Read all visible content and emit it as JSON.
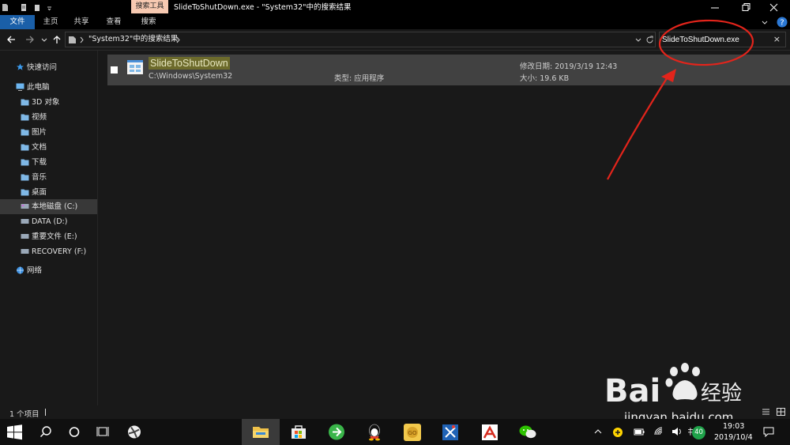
{
  "window": {
    "title": "SlideToShutDown.exe - \"System32\"中的搜索结果",
    "context_tab": "搜索工具"
  },
  "ribbon": {
    "tabs": [
      {
        "label": "文件"
      },
      {
        "label": "主页"
      },
      {
        "label": "共享"
      },
      {
        "label": "查看"
      },
      {
        "label": "搜索"
      }
    ]
  },
  "address": {
    "breadcrumb": "\"System32\"中的搜索结果"
  },
  "search": {
    "value": "SlideToShutDown.exe",
    "clear_icon": "×"
  },
  "sidebar": {
    "items": [
      {
        "label": "快速访问",
        "icon": "star-icon"
      },
      {
        "label": "此电脑",
        "icon": "pc-icon"
      },
      {
        "label": "3D 对象",
        "icon": "folder-icon"
      },
      {
        "label": "视频",
        "icon": "folder-icon"
      },
      {
        "label": "图片",
        "icon": "folder-icon"
      },
      {
        "label": "文档",
        "icon": "folder-icon"
      },
      {
        "label": "下载",
        "icon": "folder-icon"
      },
      {
        "label": "音乐",
        "icon": "folder-icon"
      },
      {
        "label": "桌面",
        "icon": "folder-icon"
      },
      {
        "label": "本地磁盘 (C:)",
        "icon": "drive-icon",
        "selected": true
      },
      {
        "label": "DATA (D:)",
        "icon": "drive-icon"
      },
      {
        "label": "重要文件 (E:)",
        "icon": "drive-icon"
      },
      {
        "label": "RECOVERY (F:)",
        "icon": "drive-icon"
      },
      {
        "label": "网络",
        "icon": "network-icon"
      }
    ]
  },
  "results": [
    {
      "name": "SlideToShutDown",
      "path": "C:\\Windows\\System32",
      "type": "类型: 应用程序",
      "modified": "修改日期: 2019/3/19 12:43",
      "size": "大小: 19.6 KB"
    }
  ],
  "status": {
    "count": "1 个项目"
  },
  "watermark": {
    "url": "jingyan.baidu.com"
  },
  "taskbar": {
    "time": "19:03",
    "date": "2019/10/4",
    "badge": "40"
  },
  "colors": {
    "accent": "#1a5fa8",
    "annotation": "#e3241b",
    "highlight": "#6d6b2c"
  }
}
